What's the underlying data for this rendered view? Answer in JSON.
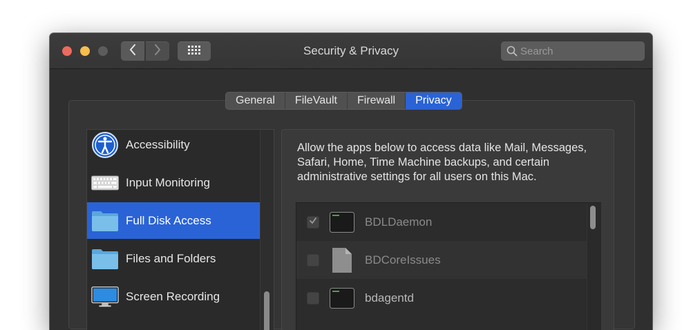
{
  "window": {
    "title": "Security & Privacy",
    "search": {
      "placeholder": "Search",
      "value": ""
    }
  },
  "tabs": [
    {
      "label": "General",
      "active": false
    },
    {
      "label": "FileVault",
      "active": false
    },
    {
      "label": "Firewall",
      "active": false
    },
    {
      "label": "Privacy",
      "active": true
    }
  ],
  "sidebar": {
    "items": [
      {
        "label": "Accessibility",
        "icon": "accessibility-icon"
      },
      {
        "label": "Input Monitoring",
        "icon": "keyboard-icon"
      },
      {
        "label": "Full Disk Access",
        "icon": "folder-icon",
        "selected": true
      },
      {
        "label": "Files and Folders",
        "icon": "folder-icon"
      },
      {
        "label": "Screen Recording",
        "icon": "display-icon"
      }
    ]
  },
  "privacy": {
    "description": "Allow the apps below to access data like Mail, Messages, Safari, Home, Time Machine backups, and certain administrative settings for all users on this Mac.",
    "apps": [
      {
        "name": "BDLDaemon",
        "checked": true,
        "icon": "terminal-icon"
      },
      {
        "name": "BDCoreIssues",
        "checked": false,
        "icon": "document-icon"
      },
      {
        "name": "bdagentd",
        "checked": false,
        "icon": "terminal-icon"
      }
    ]
  },
  "colors": {
    "accent": "#2a63d6",
    "close": "#ed6a5e",
    "minimize": "#f5be4f"
  }
}
